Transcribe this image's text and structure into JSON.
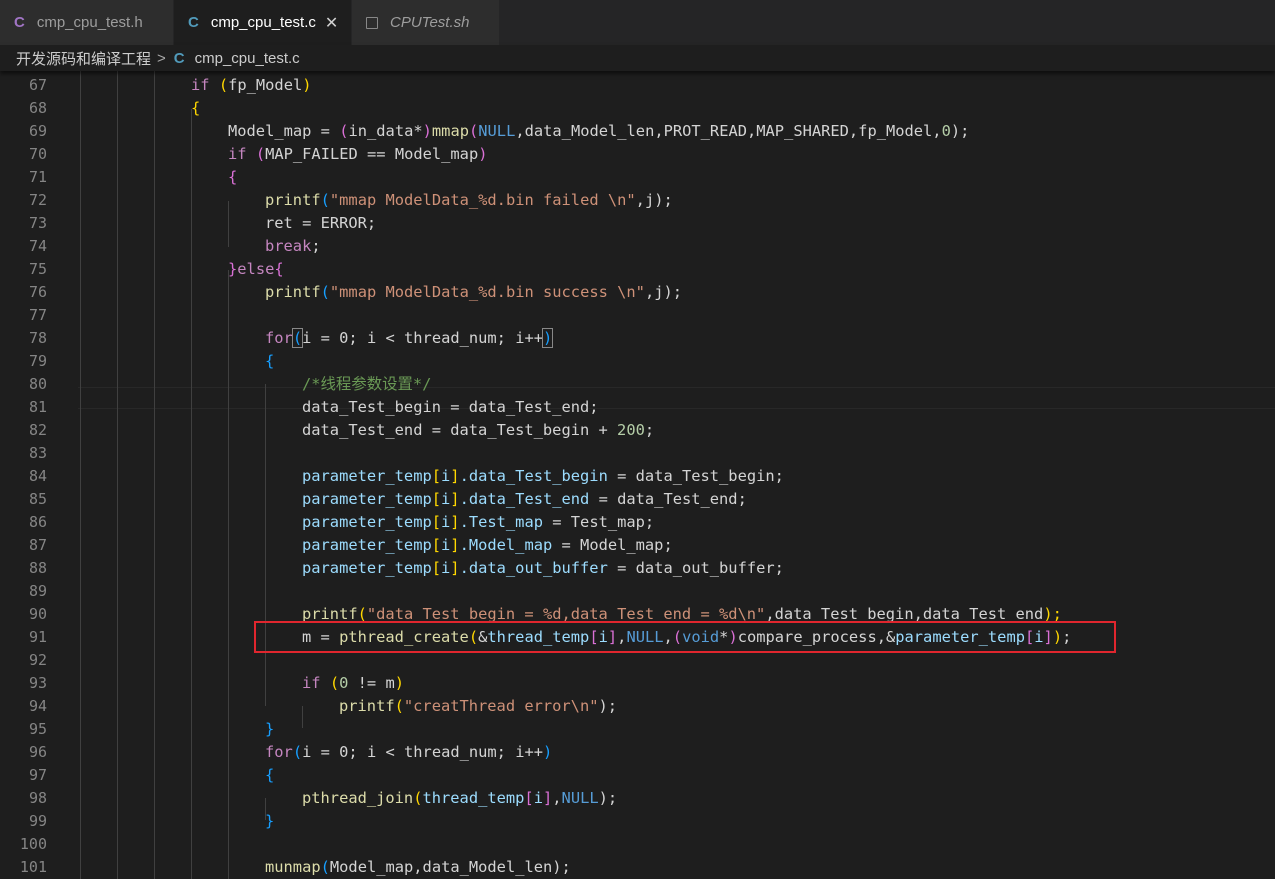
{
  "tabs": [
    {
      "icon": "C",
      "label": "cmp_cpu_test.h",
      "active": false
    },
    {
      "icon": "C",
      "label": "cmp_cpu_test.c",
      "active": true,
      "close": "✕"
    },
    {
      "icon": "shell-script-icon",
      "label": "CPUTest.sh",
      "active": false
    }
  ],
  "breadcrumb": {
    "folder": "开发源码和编译工程",
    "separator": ">",
    "file_icon": "C",
    "file": "cmp_cpu_test.c"
  },
  "line_numbers": [
    "67",
    "68",
    "69",
    "70",
    "71",
    "72",
    "73",
    "74",
    "75",
    "76",
    "77",
    "78",
    "79",
    "80",
    "81",
    "82",
    "83",
    "84",
    "85",
    "86",
    "87",
    "88",
    "89",
    "90",
    "91",
    "92",
    "93",
    "94",
    "95",
    "96",
    "97",
    "98",
    "99",
    "100",
    "101"
  ],
  "code": {
    "l67": [
      "if",
      " (",
      "fp_Model",
      ")"
    ],
    "l68": [
      "{"
    ],
    "l69": [
      "Model_map = ",
      "(",
      "in_data*",
      ")",
      "mmap",
      "(",
      "NULL",
      ",data_Model_len,PROT_READ,MAP_SHARED,fp_Model,",
      "0",
      ");"
    ],
    "l70": [
      "if",
      " (",
      "MAP_FAILED == Model_map",
      ")"
    ],
    "l71": [
      "{"
    ],
    "l72": [
      "printf",
      "(",
      "\"mmap ModelData_%d.bin failed \\n\"",
      ",j);"
    ],
    "l73": [
      "ret = ERROR;"
    ],
    "l74": [
      "break",
      ";"
    ],
    "l75": [
      "}",
      "else",
      "{"
    ],
    "l76": [
      "printf",
      "(",
      "\"mmap ModelData_%d.bin success \\n\"",
      ",j);"
    ],
    "l78": [
      "for",
      "(",
      "i = 0; i < thread_num; i++",
      ")"
    ],
    "l79": [
      "{"
    ],
    "l80": [
      "/*线程参数设置*/"
    ],
    "l81": [
      "data_Test_begin = data_Test_end;"
    ],
    "l82": [
      "data_Test_end = data_Test_begin + ",
      "200",
      ";"
    ],
    "l84": [
      "parameter_temp",
      "[",
      "i",
      "]",
      ".data_Test_begin",
      " = data_Test_begin;"
    ],
    "l85": [
      "parameter_temp",
      "[",
      "i",
      "]",
      ".data_Test_end",
      " = data_Test_end;"
    ],
    "l86": [
      "parameter_temp",
      "[",
      "i",
      "]",
      ".Test_map",
      " = Test_map;"
    ],
    "l87": [
      "parameter_temp",
      "[",
      "i",
      "]",
      ".Model_map",
      " = Model_map;"
    ],
    "l88": [
      "parameter_temp",
      "[",
      "i",
      "]",
      ".data_out_buffer",
      " = data_out_buffer;"
    ],
    "l90": [
      "printf",
      "(",
      "\"data_Test_begin = %d,data_Test_end = %d\\n\"",
      ",data_Test_begin,data_Test_end",
      ");"
    ],
    "l91": [
      "m = ",
      "pthread_create",
      "(",
      "&",
      "thread_temp",
      "[",
      "i",
      "]",
      ",",
      "NULL",
      ",",
      "(",
      "void",
      "*",
      ")",
      "compare_process,&",
      "parameter_temp",
      "[",
      "i",
      "]",
      ")",
      ";"
    ],
    "l93": [
      "if",
      " (",
      "0",
      " != m",
      ")"
    ],
    "l94": [
      "printf",
      "(",
      "\"creatThread error\\n\"",
      ");"
    ],
    "l95": [
      "}"
    ],
    "l96": [
      "for",
      "(",
      "i = 0; i < thread_num; i++",
      ")"
    ],
    "l97": [
      "{"
    ],
    "l98": [
      "pthread_join",
      "(",
      "thread_temp",
      "[",
      "i",
      "]",
      ",",
      "NULL",
      ");"
    ],
    "l99": [
      "}"
    ],
    "l101": [
      "munmap",
      "(",
      "Model_map,data_Model_len",
      ");"
    ]
  },
  "colors": {
    "background": "#1e1e1e",
    "highlight_box": "#e0262e",
    "keyword": "#c586c0",
    "string": "#ce9178",
    "function": "#dcdcaa"
  }
}
